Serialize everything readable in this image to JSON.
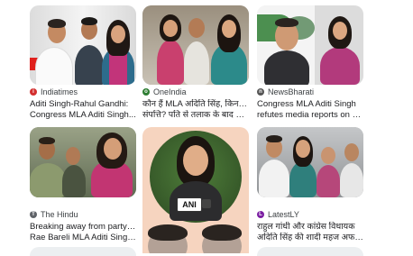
{
  "results": [
    {
      "source": "Indiatimes",
      "icon": "indiatimes-icon",
      "line1": "Aditi Singh-Rahul Gandhi:",
      "line2": "Congress MLA Aditi Singh..."
    },
    {
      "source": "OneIndia",
      "icon": "oneindia-icon",
      "line1": "कौन हैं MLA अदिति सिंह, किननी है",
      "line2": "संपत्ति? पति से तलाक के बाद चर्चा में..."
    },
    {
      "source": "NewsBharati",
      "icon": "newsbharati-icon",
      "line1": "Congress MLA Aditi Singh",
      "line2": "refutes media reports on Rahu..."
    },
    {
      "source": "The Hindu",
      "icon": "thehindu-icon",
      "line1": "Breaking away from party line,",
      "line2": "Rae Bareli MLA Aditi Singh..."
    },
    {
      "source": "",
      "icon": "",
      "line1": "",
      "line2": ""
    },
    {
      "source": "LatestLY",
      "icon": "latestly-icon",
      "line1": "राहुल गांधी और कांग्रेस विधायक",
      "line2": "अदिति सिंह की शादी महज अफवाह..."
    }
  ],
  "overlay_text": {
    "ani_logo": "ANI"
  }
}
